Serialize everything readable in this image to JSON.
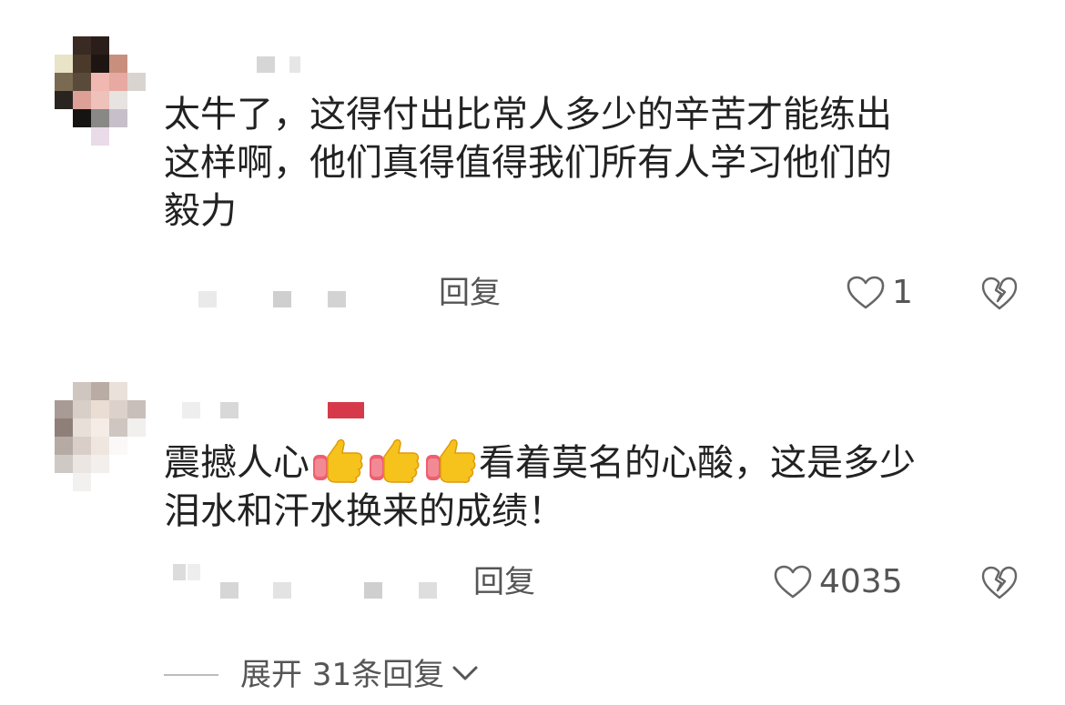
{
  "comments": [
    {
      "text_line1": "太牛了，这得付出比常人多少的辛苦才能练出",
      "text_line2": "这样啊，他们真得值得我们所有人学习他们的",
      "text_line3": "毅力",
      "reply_label": "回复",
      "like_count": "1",
      "icons": [
        "heart-outline-icon",
        "broken-heart-icon"
      ]
    },
    {
      "text_start": "震撼人心",
      "emoji": [
        "thumbs-up",
        "thumbs-up",
        "thumbs-up"
      ],
      "text_after": "看着莫名的心酸，这是多少",
      "text_line2": "泪水和汗水换来的成绩！",
      "reply_label": "回复",
      "like_count": "4035",
      "icons": [
        "heart-outline-icon",
        "broken-heart-icon"
      ]
    }
  ],
  "expand_replies": {
    "label": "展开 31条回复",
    "icon": "chevron-down-icon"
  },
  "colors": {
    "text": "#222222",
    "secondary": "#555555",
    "badge": "#d63a4a"
  }
}
